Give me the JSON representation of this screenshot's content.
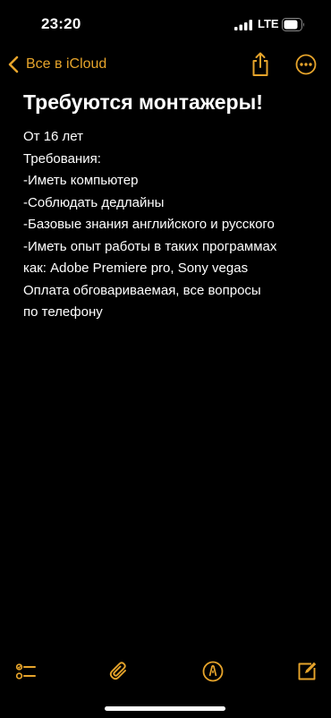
{
  "status_bar": {
    "time": "23:20",
    "network": "LTE"
  },
  "nav": {
    "back_label": "Все в iCloud",
    "accent_color": "#e6a42b"
  },
  "note": {
    "title": "Требуются монтажеры!",
    "lines": [
      "От 16 лет",
      "Требования:",
      "-Иметь компьютер",
      "-Соблюдать дедлайны",
      "-Базовые знания английского и русского",
      "-Иметь опыт работы в таких программах",
      "как: Adobe Premiere pro, Sony vegas",
      "Оплата обговариваемая, все вопросы",
      "по телефону"
    ]
  },
  "toolbar": {
    "icons": [
      "checklist-icon",
      "paperclip-icon",
      "markup-pen-icon",
      "compose-icon"
    ]
  }
}
